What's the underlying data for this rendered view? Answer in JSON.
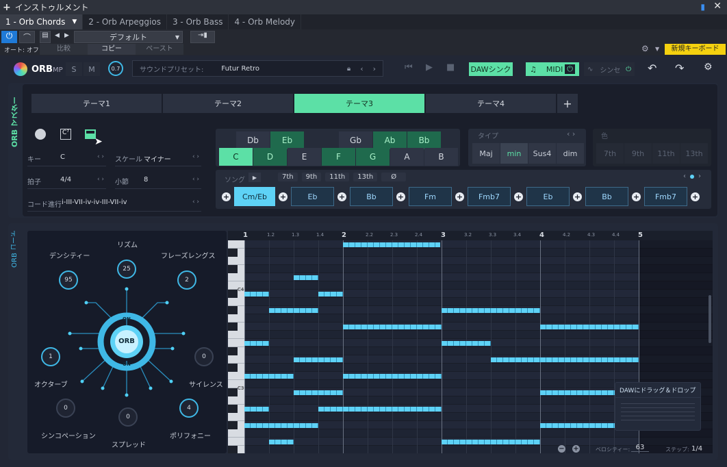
{
  "titlebar": {
    "plus": "+",
    "title": "インストゥルメント"
  },
  "tabs": [
    "1 - Orb Chords",
    "2 - Orb Arpeggios",
    "3 - Orb Bass",
    "4 - Orb Melody"
  ],
  "toolbar": {
    "preset": "デフォルト",
    "auto": "オート: オフ",
    "compare": "比較",
    "copy": "コピー",
    "paste": "ペースト",
    "new_keyboard": "新規キーボード"
  },
  "header": {
    "logo": "ORB",
    "logo_mp": "MP",
    "s": "S",
    "m": "M",
    "knob": "0.7",
    "preset_label": "サウンドプリセット:",
    "preset_value": "Futur Retro",
    "daw_sync": "DAWシンク",
    "midi": "MIDI",
    "synth": "シンセ"
  },
  "master": {
    "side_label": "ORB マスター",
    "themes": [
      "テーマ1",
      "テーマ2",
      "テーマ3",
      "テーマ4"
    ],
    "active_theme": 2,
    "add": "+"
  },
  "params": {
    "key_label": "キー",
    "key": "C",
    "scale_label": "スケール",
    "scale": "マイナー",
    "time_label": "拍子",
    "time": "4/4",
    "bars_label": "小節",
    "bars": "8",
    "prog_label": "コード進行",
    "prog": "i-III-VII-iv-iv-III-VII-iv"
  },
  "keys": {
    "sharps": [
      "Db",
      "Eb",
      "",
      "Gb",
      "Ab",
      "Bb"
    ],
    "naturals": [
      "C",
      "D",
      "E",
      "F",
      "G",
      "A",
      "B"
    ]
  },
  "types": {
    "label": "タイプ",
    "items": [
      "Maj",
      "min",
      "Sus4",
      "dim"
    ],
    "color_label": "色",
    "extensions": [
      "7th",
      "9th",
      "11th",
      "13th"
    ]
  },
  "song": {
    "label": "ソング",
    "ext": [
      "7th",
      "9th",
      "11th",
      "13th",
      "Ø"
    ],
    "chords": [
      "Cm/Eb",
      "Eb",
      "Bb",
      "Fm",
      "Fmb7",
      "Eb",
      "Bb",
      "Fmb7"
    ]
  },
  "orb": {
    "side_label": "ORB コード",
    "center": "ORB",
    "on_top": "ON",
    "on_bottom": "ON",
    "knobs": [
      {
        "name": "リズム",
        "value": "25"
      },
      {
        "name": "デンシティー",
        "value": "95"
      },
      {
        "name": "フレーズレングス",
        "value": "2"
      },
      {
        "name": "オクターブ",
        "value": "1"
      },
      {
        "name": "サイレンス",
        "value": "0"
      },
      {
        "name": "シンコペーション",
        "value": "0"
      },
      {
        "name": "スプレッド",
        "value": "0"
      },
      {
        "name": "ポリフォニー",
        "value": "4"
      }
    ]
  },
  "roll": {
    "bars": [
      "1",
      "1.2",
      "1.3",
      "1.4",
      "2",
      "2.2",
      "2.3",
      "2.4",
      "3",
      "3.2",
      "3.3",
      "3.4",
      "4",
      "4.2",
      "4.3",
      "4.4",
      "5"
    ],
    "c_labels": [
      "C4",
      "C3"
    ],
    "drag": "DAWにドラッグ＆ドロップ",
    "velocity_label": "ベロシティー:",
    "velocity": "63",
    "step_label": "ステップ:",
    "step": "1/4"
  },
  "colors": {
    "accent": "#5ce0a6",
    "cyan": "#5ed2f6",
    "bg": "#222735"
  }
}
